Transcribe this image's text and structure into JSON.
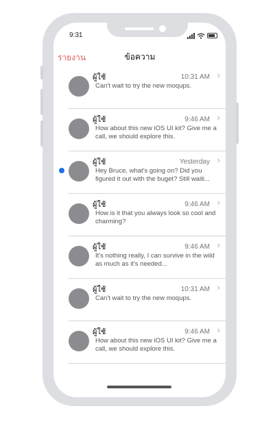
{
  "status_bar": {
    "time": "9:31"
  },
  "nav": {
    "back_label": "รายงาน",
    "title": "ข้อความ"
  },
  "messages": [
    {
      "sender": "ผู้ใช้",
      "time": "10:31 AM",
      "preview": "Can't wait to try the new moqups.",
      "unread": false
    },
    {
      "sender": "ผู้ใช้",
      "time": "9:46 AM",
      "preview": "How about this new iOS UI kit? Give me a call, we should explore this.",
      "unread": false
    },
    {
      "sender": "ผู้ใช้",
      "time": "Yesterday",
      "preview": "Hey Bruce, what's going on? Did you figured it out with the buget? Still waiti...",
      "unread": true
    },
    {
      "sender": "ผู้ใช้",
      "time": "9:46 AM",
      "preview": "How is it that you always look so cool and charming?",
      "unread": false
    },
    {
      "sender": "ผู้ใช้",
      "time": "9:46 AM",
      "preview": "It's nothing really, I can survive in the wild as much as it's needed...",
      "unread": false
    },
    {
      "sender": "ผู้ใช้",
      "time": "10:31 AM",
      "preview": "Can't wait to try the new moqups.",
      "unread": false
    },
    {
      "sender": "ผู้ใช้",
      "time": "9:46 AM",
      "preview": "How about this new iOS UI kit? Give me a call, we should explore this.",
      "unread": false
    }
  ],
  "icons": {
    "chevron": "chevron-right-icon",
    "signal": "signal-icon",
    "wifi": "wifi-icon",
    "battery": "battery-icon"
  },
  "colors": {
    "accent": "#e45b5b",
    "unread_dot": "#1a73e8",
    "avatar": "#8c8c90"
  }
}
